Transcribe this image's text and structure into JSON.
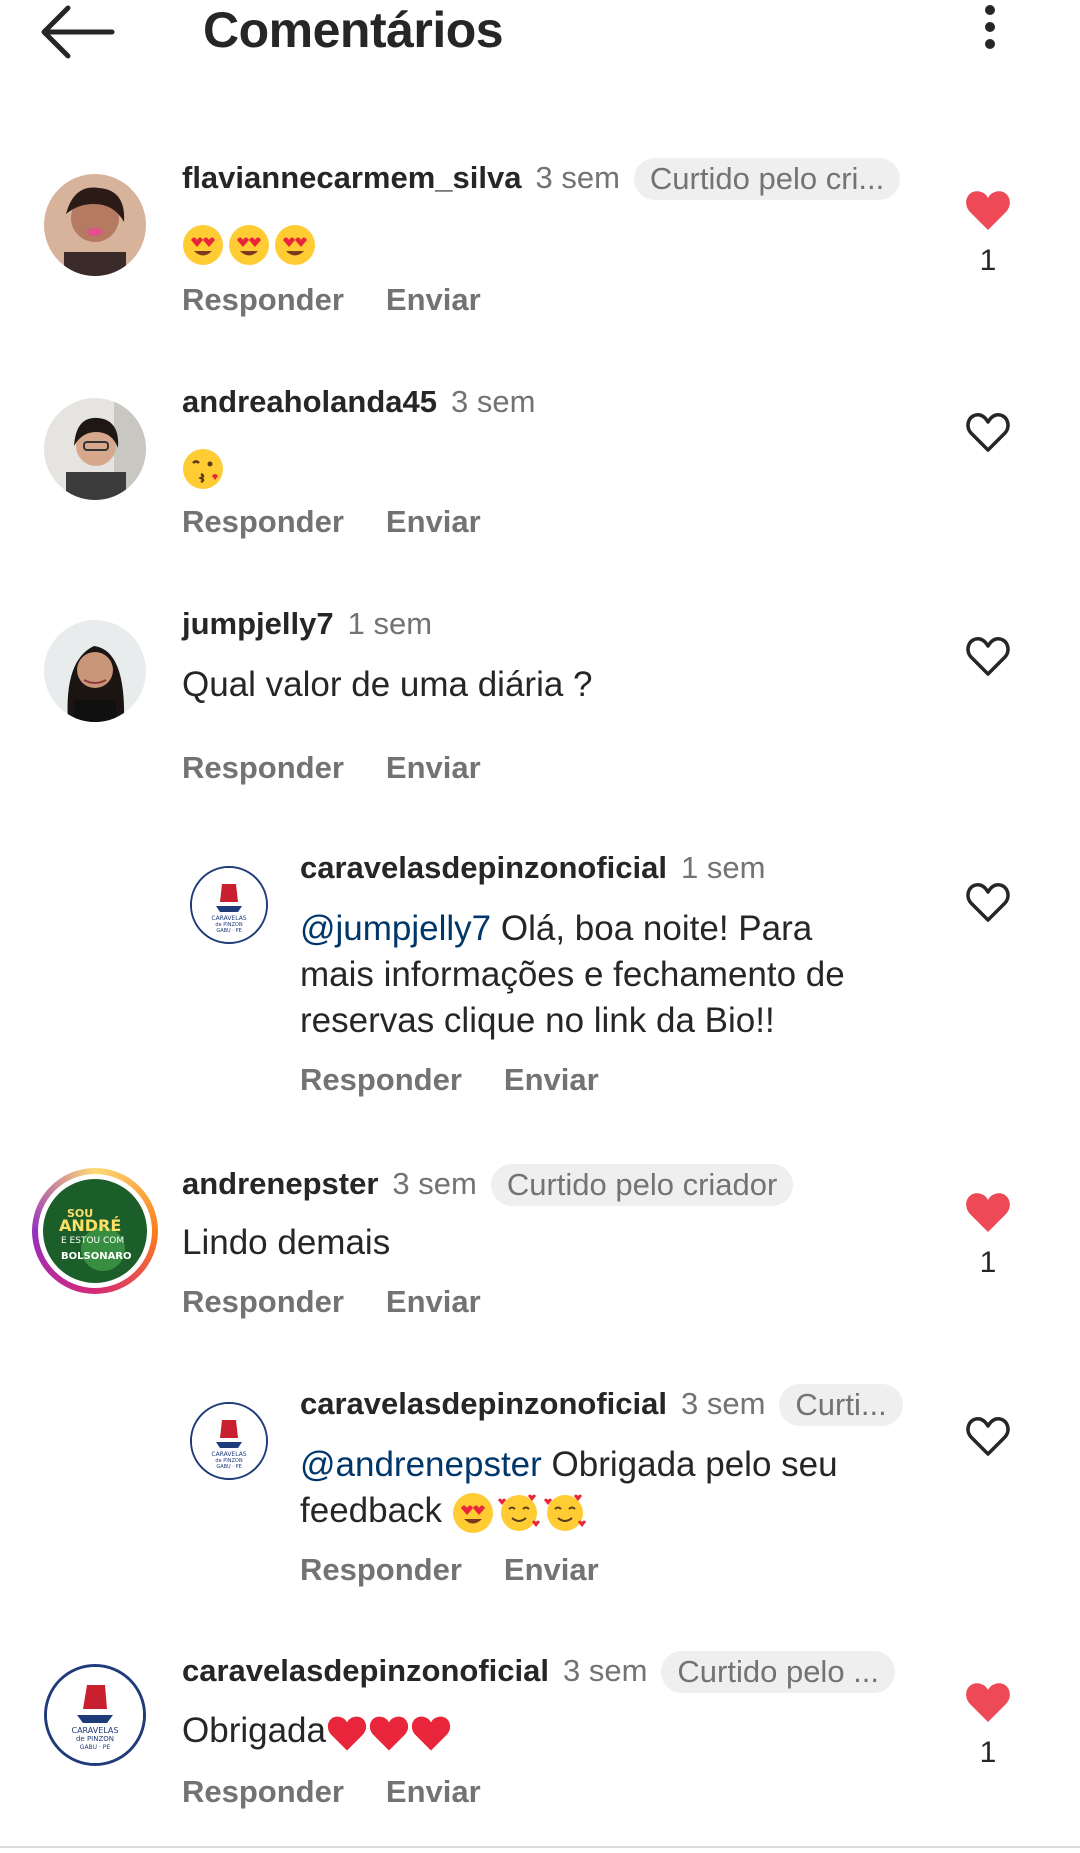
{
  "header": {
    "title": "Comentários",
    "back_icon": "arrow-left-icon",
    "more_icon": "more-vertical-icon"
  },
  "actions": {
    "reply": "Responder",
    "send": "Enviar"
  },
  "comments": [
    {
      "username": "flaviannecarmem_silva",
      "time": "3 sem",
      "liked_badge": "Curtido pelo cri...",
      "text": "",
      "emojis": [
        "heart-eyes",
        "heart-eyes",
        "heart-eyes"
      ],
      "liked": true,
      "likes": "1"
    },
    {
      "username": "andreaholanda45",
      "time": "3 sem",
      "text": "",
      "emojis": [
        "kiss-face"
      ],
      "liked": false
    },
    {
      "username": "jumpjelly7",
      "time": "1 sem",
      "text": "Qual valor de uma diária ?",
      "liked": false
    },
    {
      "username": "caravelasdepinzonoficial",
      "time": "1 sem",
      "mention": "@jumpjelly7",
      "text_lines": [
        "Olá, boa noite! Para",
        "mais informações e fechamento de",
        "reservas clique no link da Bio!!"
      ],
      "liked": false,
      "is_reply": true
    },
    {
      "username": "andrenepster",
      "time": "3 sem",
      "liked_badge": "Curtido pelo criador",
      "text": "Lindo demais",
      "liked": true,
      "likes": "1",
      "avatar_text": [
        "SOU",
        "ANDRÉ",
        "E ESTOU COM",
        "BOLSONARO"
      ]
    },
    {
      "username": "caravelasdepinzonoficial",
      "time": "3 sem",
      "liked_badge": "Curti...",
      "mention": "@andrenepster",
      "text_lines": [
        "Obrigada pelo seu",
        "feedback"
      ],
      "emojis": [
        "heart-eyes",
        "smiling-hearts",
        "smiling-hearts"
      ],
      "liked": false,
      "is_reply": true
    },
    {
      "username": "caravelasdepinzonoficial",
      "time": "3 sem",
      "liked_badge": "Curtido pelo ...",
      "text": "Obrigada",
      "emojis": [
        "red-heart",
        "red-heart",
        "red-heart"
      ],
      "liked": true,
      "likes": "1"
    }
  ],
  "brand_logo": {
    "lines": [
      "CARAVELAS",
      "de PINZON",
      "GABU · PE"
    ]
  },
  "colors": {
    "like_red": "#ed4956",
    "mention_blue": "#00376b",
    "secondary_text": "#737373",
    "badge_bg": "#efefef"
  }
}
